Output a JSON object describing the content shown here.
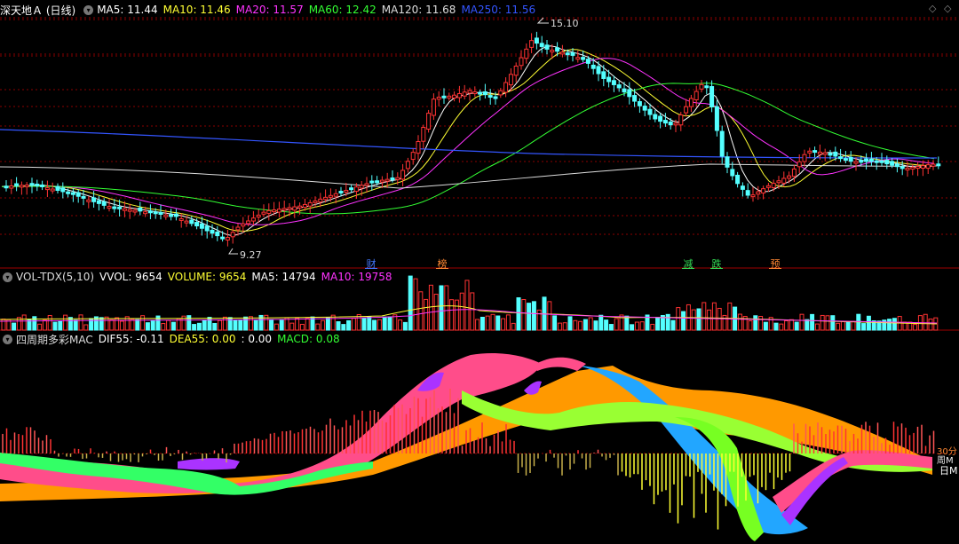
{
  "main": {
    "title": "深天地Ａ (日线)",
    "ma": [
      {
        "label": "MA5: 11.44",
        "color": "#ffffff"
      },
      {
        "label": "MA10: 11.46",
        "color": "#ffff33"
      },
      {
        "label": "MA20: 11.57",
        "color": "#ff33ff"
      },
      {
        "label": "MA60: 12.42",
        "color": "#33ff33"
      },
      {
        "label": "MA120: 11.68",
        "color": "#dddddd"
      },
      {
        "label": "MA250: 11.56",
        "color": "#3355ff"
      }
    ],
    "high_label": "15.10",
    "low_label": "9.27",
    "events": [
      {
        "label": "财",
        "color": "#4477ff"
      },
      {
        "label": "榜",
        "color": "#ff8833"
      },
      {
        "label": "减",
        "color": "#33dd55"
      },
      {
        "label": "跌",
        "color": "#33dd55"
      },
      {
        "label": "预",
        "color": "#ff8833"
      }
    ]
  },
  "vol": {
    "title": "VOL-TDX(5,10)",
    "items": [
      {
        "label": "VVOL: 9654",
        "color": "#ffffff"
      },
      {
        "label": "VOLUME: 9654",
        "color": "#ffff33"
      },
      {
        "label": "MA5: 14794",
        "color": "#ffffff"
      },
      {
        "label": "MA10: 19758",
        "color": "#ff33ff"
      }
    ]
  },
  "mac": {
    "title": "四周期多彩MAC",
    "items": [
      {
        "label": "DIF55: -0.11",
        "color": "#ffffff"
      },
      {
        "label": "DEA55: 0.00",
        "color": "#ffff33"
      },
      {
        "label": ": 0.00",
        "color": "#ffffff"
      },
      {
        "label": "MACD: 0.08",
        "color": "#33ff33"
      }
    ],
    "right_labels": [
      "30分",
      "周M",
      "日M"
    ]
  },
  "colors": {
    "up": "#ff3333",
    "down": "#54ffff",
    "grid": "#8b0000",
    "sep": "#a00000"
  }
}
